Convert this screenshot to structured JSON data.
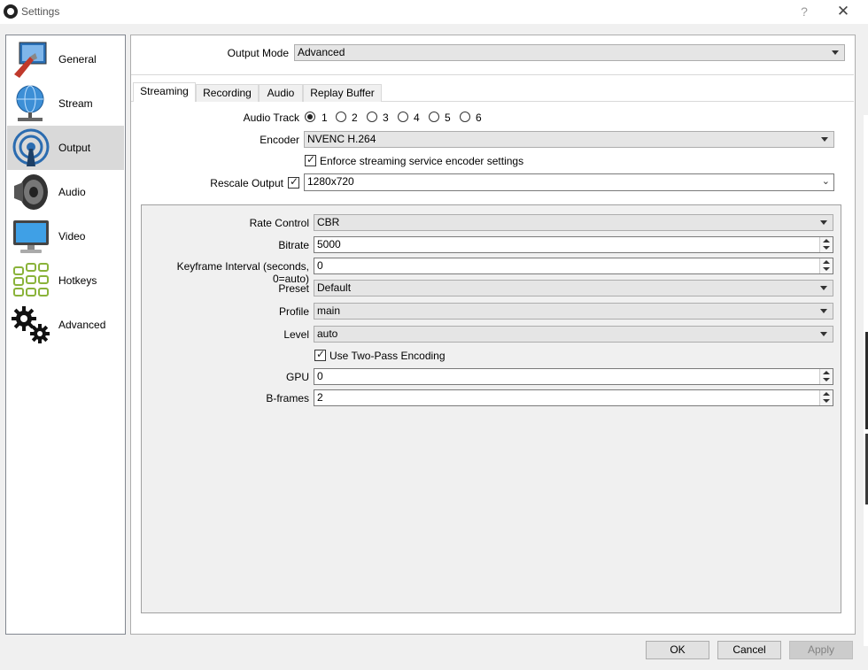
{
  "window": {
    "title": "Settings",
    "help": "?",
    "close": "✕"
  },
  "sidebar": {
    "items": [
      {
        "label": "General",
        "icon": "general-monitor-icon"
      },
      {
        "label": "Stream",
        "icon": "globe-stream-icon"
      },
      {
        "label": "Output",
        "icon": "broadcast-icon",
        "active": true
      },
      {
        "label": "Audio",
        "icon": "speaker-icon"
      },
      {
        "label": "Video",
        "icon": "monitor-icon"
      },
      {
        "label": "Hotkeys",
        "icon": "keyboard-icon"
      },
      {
        "label": "Advanced",
        "icon": "gears-icon"
      }
    ]
  },
  "output_mode": {
    "label": "Output Mode",
    "value": "Advanced"
  },
  "tabs": [
    "Streaming",
    "Recording",
    "Audio",
    "Replay Buffer"
  ],
  "streaming": {
    "audio_track": {
      "label": "Audio Track",
      "options": [
        "1",
        "2",
        "3",
        "4",
        "5",
        "6"
      ],
      "selected": "1"
    },
    "encoder": {
      "label": "Encoder",
      "value": "NVENC H.264"
    },
    "enforce": {
      "label": "Enforce streaming service encoder settings",
      "checked": true
    },
    "rescale": {
      "label": "Rescale Output",
      "checked": true,
      "value": "1280x720"
    }
  },
  "encoder_settings": {
    "rate_control": {
      "label": "Rate Control",
      "value": "CBR"
    },
    "bitrate": {
      "label": "Bitrate",
      "value": "5000"
    },
    "keyframe": {
      "label": "Keyframe Interval (seconds, 0=auto)",
      "value": "0"
    },
    "preset": {
      "label": "Preset",
      "value": "Default"
    },
    "profile": {
      "label": "Profile",
      "value": "main"
    },
    "level": {
      "label": "Level",
      "value": "auto"
    },
    "two_pass": {
      "label": "Use Two-Pass Encoding",
      "checked": true
    },
    "gpu": {
      "label": "GPU",
      "value": "0"
    },
    "bframes": {
      "label": "B-frames",
      "value": "2"
    }
  },
  "buttons": {
    "ok": "OK",
    "cancel": "Cancel",
    "apply": "Apply"
  }
}
